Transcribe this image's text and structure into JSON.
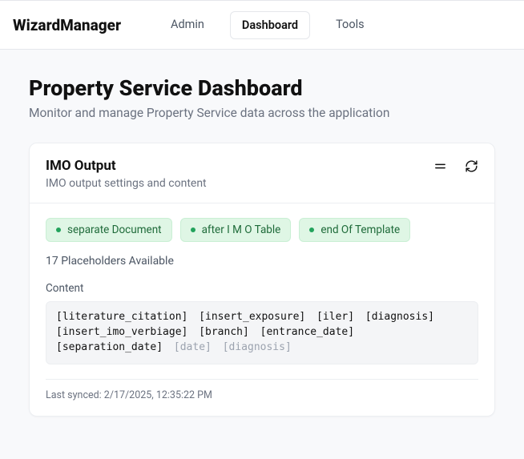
{
  "brand": "WizardManager",
  "nav": {
    "admin": "Admin",
    "dashboard": "Dashboard",
    "tools": "Tools"
  },
  "page": {
    "title": "Property Service Dashboard",
    "subtitle": "Monitor and manage Property Service data across the application"
  },
  "card": {
    "title": "IMO Output",
    "subtitle": "IMO output settings and content",
    "badges": {
      "separateDocument": "separate Document",
      "afterImoTable": "after I M O Table",
      "endOfTemplate": "end Of Template"
    },
    "placeholderCount": "17 Placeholders Available",
    "contentLabel": "Content",
    "tokens": {
      "t0": "[literature_citation]",
      "t1": "[insert_exposure]",
      "t2": "[iler]",
      "t3": "[diagnosis]",
      "t4": "[insert_imo_verbiage]",
      "t5": "[branch]",
      "t6": "[entrance_date]",
      "t7": "[separation_date]",
      "t8": "[date]",
      "t9": "[diagnosis]"
    },
    "syncLabel": "Last synced: 2/17/2025, 12:35:22 PM"
  }
}
